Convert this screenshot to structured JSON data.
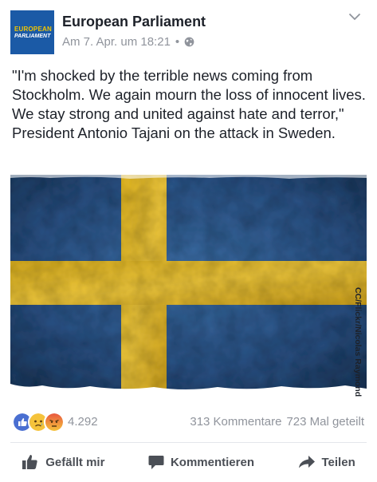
{
  "page": {
    "name": "European Parliament",
    "avatar_line1": "EUROPEAN",
    "avatar_line2": "PARLIAMENT",
    "timestamp": "Am 7. Apr. um 18:21",
    "separator": "•"
  },
  "post": {
    "text": "\"I'm shocked by the terrible news coming from Stockholm. We again mourn the loss of innocent lives. We stay strong and united against hate and terror,\" President Antonio Tajani on the attack in Sweden.",
    "image_credit": "CC/Flickr/Nicolas Raymond"
  },
  "stats": {
    "reaction_count": "4.292",
    "comments": "313 Kommentare",
    "shares": "723 Mal geteilt"
  },
  "actions": {
    "like": "Gefällt mir",
    "comment": "Kommentieren",
    "share": "Teilen"
  },
  "colors": {
    "flag_blue": "#2a4f80",
    "flag_yellow": "#e0b92a",
    "like_blue": "#4a6fd1",
    "meta_gray": "#90949c"
  }
}
